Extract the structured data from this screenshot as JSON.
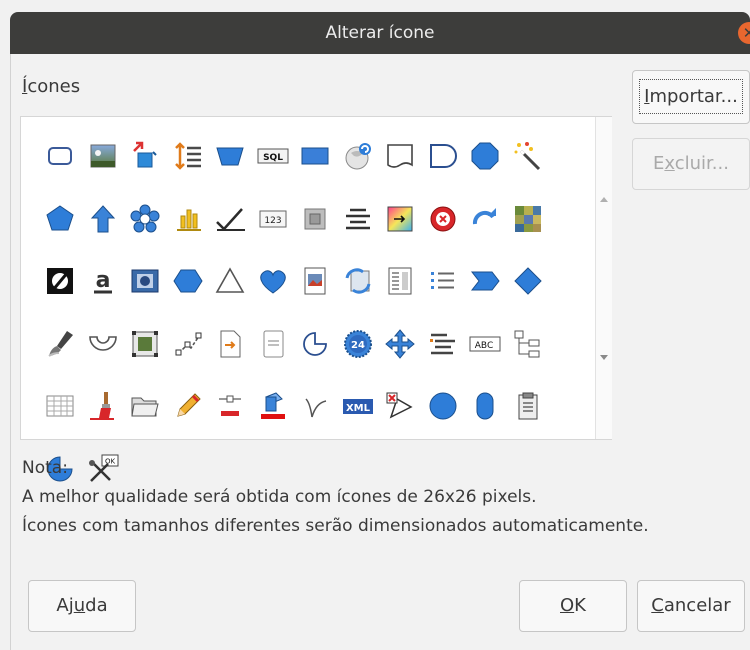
{
  "window": {
    "title": "Alterar ícone",
    "close_glyph": "✕"
  },
  "icons_label": "Ícones",
  "buttons": {
    "import": "Importar...",
    "delete": "Excluir...",
    "help": "Ajuda",
    "ok": "OK",
    "cancel": "Cancelar"
  },
  "note": {
    "heading": "Nota:",
    "line1": "A melhor qualidade será obtida com ícones de 26x26 pixels.",
    "line2": "Ícones com tamanhos diferentes serão dimensionados automaticamente."
  },
  "icon_texts": {
    "sql": "SQL",
    "n123": "123",
    "n24": "24",
    "abc": "ABC",
    "xml": "XML",
    "ok": "OK"
  },
  "icons": [
    "rectangle-icon",
    "image-icon",
    "resize-arrows-icon",
    "line-spacing-icon",
    "trapezoid-icon",
    "sql-icon",
    "flat-rectangle-icon",
    "refresh-globe-icon",
    "flowchart-document-icon",
    "flowchart-delay-icon",
    "octagon-icon",
    "magic-wand-icon",
    "pentagon-icon",
    "arrow-up-icon",
    "flower-icon",
    "chart-bars-icon",
    "checkmark-icon",
    "number-field-icon",
    "square-frame-icon",
    "align-lines-icon",
    "color-gradient-icon",
    "close-circle-icon",
    "redo-arrow-icon",
    "mosaic-icon",
    "no-fill-icon",
    "font-color-icon",
    "image-frame-icon",
    "hexagon-icon",
    "triangle-icon",
    "heart-icon",
    "document-image-icon",
    "sync-arrows-icon",
    "text-columns-icon",
    "bullet-list-icon",
    "chevron-shape-icon",
    "diamond-icon",
    "brush-stroke-icon",
    "block-arc-icon",
    "image-size-icon",
    "connector-points-icon",
    "insert-page-icon",
    "blank-page-icon",
    "arc-icon",
    "badge-24-icon",
    "move-arrows-icon",
    "outline-list-icon",
    "text-field-icon",
    "tree-view-icon",
    "table-grid-icon",
    "paint-brush-icon",
    "open-folder-icon",
    "pencil-icon",
    "line-color-icon",
    "fill-color-icon",
    "curve-icon",
    "xml-icon",
    "crop-shape-icon",
    "circle-icon",
    "flowchart-terminator-icon",
    "paste-document-icon",
    "pie-icon",
    "macro-ok-icon"
  ]
}
